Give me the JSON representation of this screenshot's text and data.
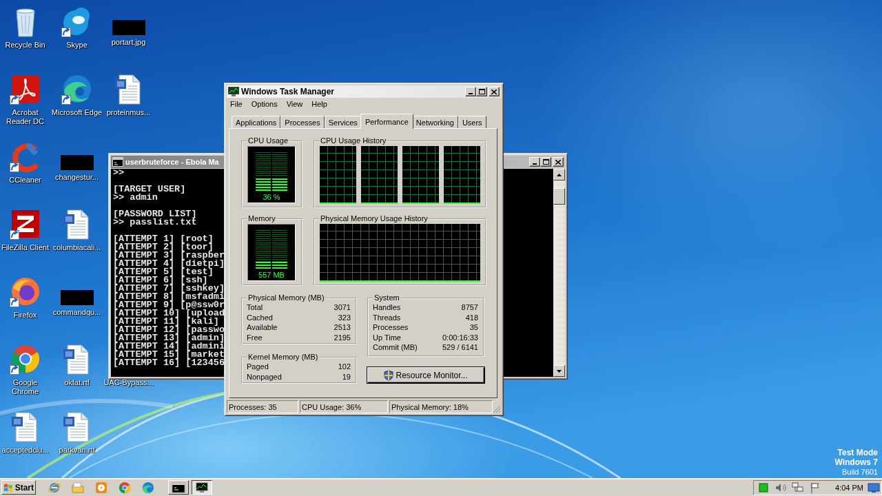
{
  "desktop": {
    "icons": [
      {
        "label": "Recycle Bin",
        "kind": "recycle-bin",
        "shortcut": false
      },
      {
        "label": "Acrobat Reader DC",
        "kind": "acrobat",
        "shortcut": true
      },
      {
        "label": "CCleaner",
        "kind": "ccleaner",
        "shortcut": true
      },
      {
        "label": "FileZilla Client",
        "kind": "filezilla",
        "shortcut": true
      },
      {
        "label": "Firefox",
        "kind": "firefox",
        "shortcut": true
      },
      {
        "label": "Google Chrome",
        "kind": "chrome",
        "shortcut": true
      },
      {
        "label": "acceptedclu...",
        "kind": "word",
        "shortcut": false
      },
      {
        "label": "Skype",
        "kind": "skype",
        "shortcut": true
      },
      {
        "label": "Microsoft Edge",
        "kind": "edge",
        "shortcut": true
      },
      {
        "label": "changestur...",
        "kind": "redacted",
        "shortcut": false
      },
      {
        "label": "columbiacali...",
        "kind": "word",
        "shortcut": false
      },
      {
        "label": "commandqu...",
        "kind": "redacted",
        "shortcut": false
      },
      {
        "label": "okfat.rtf",
        "kind": "word",
        "shortcut": false
      },
      {
        "label": "parkvan.rtf",
        "kind": "word",
        "shortcut": false
      },
      {
        "label": "portart.jpg",
        "kind": "redacted",
        "shortcut": false
      },
      {
        "label": "proteinmus...",
        "kind": "word",
        "shortcut": false
      }
    ],
    "covered_icon_label": "UAC-Bypass...",
    "system_watermark": [
      "Test Mode",
      "Windows 7",
      "Build 7601"
    ]
  },
  "console_window": {
    "title": "userbruteforce - Ebola Ma",
    "blocks": [
      [
        ">>"
      ],
      [
        "[TARGET USER]",
        ">> admin"
      ],
      [
        "[PASSWORD LIST]",
        ">> passlist.txt"
      ],
      [
        "[ATTEMPT 1] [root]",
        "[ATTEMPT 2] [toor]",
        "[ATTEMPT 3] [raspber",
        "[ATTEMPT 4] [dietpi]",
        "[ATTEMPT 5] [test]",
        "[ATTEMPT 6] [ssh]",
        "[ATTEMPT 7] [sshkey]",
        "[ATTEMPT 8] [msfadmi",
        "[ATTEMPT 9] [p@ssw0r",
        "[ATTEMPT 10] [upload",
        "[ATTEMPT 11] [kali]",
        "[ATTEMPT 12] [passwo",
        "[ATTEMPT 13] [admin]",
        "[ATTEMPT 14] [admini",
        "[ATTEMPT 15] [market",
        "[ATTEMPT 16] [123456"
      ]
    ]
  },
  "task_manager": {
    "title": "Windows Task Manager",
    "menu": [
      "File",
      "Options",
      "View",
      "Help"
    ],
    "tabs": [
      {
        "label": "Applications",
        "selected": false
      },
      {
        "label": "Processes",
        "selected": false
      },
      {
        "label": "Services",
        "selected": false
      },
      {
        "label": "Performance",
        "selected": true
      },
      {
        "label": "Networking",
        "selected": false
      },
      {
        "label": "Users",
        "selected": false
      }
    ],
    "cpu_usage": {
      "title": "CPU Usage",
      "reading": "36 %",
      "level": 0.36
    },
    "cpu_usage_history": {
      "title": "CPU Usage History"
    },
    "memory": {
      "title": "Memory",
      "reading": "557 MB",
      "level": 0.18
    },
    "physical_memory_usage_history": {
      "title": "Physical Memory Usage History"
    },
    "physical_memory": {
      "title": "Physical Memory (MB)",
      "rows": [
        {
          "label": "Total",
          "value": "3071"
        },
        {
          "label": "Cached",
          "value": "323"
        },
        {
          "label": "Available",
          "value": "2513"
        },
        {
          "label": "Free",
          "value": "2195"
        }
      ]
    },
    "kernel_memory": {
      "title": "Kernel Memory (MB)",
      "rows": [
        {
          "label": "Paged",
          "value": "102"
        },
        {
          "label": "Nonpaged",
          "value": "19"
        }
      ]
    },
    "system": {
      "title": "System",
      "rows": [
        {
          "label": "Handles",
          "value": "8757"
        },
        {
          "label": "Threads",
          "value": "418"
        },
        {
          "label": "Processes",
          "value": "35"
        },
        {
          "label": "Up Time",
          "value": "0:00:16:33"
        },
        {
          "label": "Commit (MB)",
          "value": "529 / 6141"
        }
      ]
    },
    "resource_monitor_button": "Resource Monitor...",
    "status_bar": [
      "Processes: 35",
      "CPU Usage: 36%",
      "Physical Memory: 18%"
    ]
  },
  "taskbar": {
    "start": "Start",
    "quick_launch": [
      {
        "kind": "ie"
      },
      {
        "kind": "explorer"
      },
      {
        "kind": "media-player"
      },
      {
        "kind": "chrome"
      },
      {
        "kind": "edge"
      }
    ],
    "tasks": [
      {
        "kind": "console",
        "selected": false
      },
      {
        "kind": "task-manager",
        "selected": true
      }
    ],
    "tray_icons": [
      {
        "kind": "status-square"
      },
      {
        "kind": "speaker"
      },
      {
        "kind": "network"
      },
      {
        "kind": "flag"
      }
    ],
    "clock": "4:04 PM"
  }
}
